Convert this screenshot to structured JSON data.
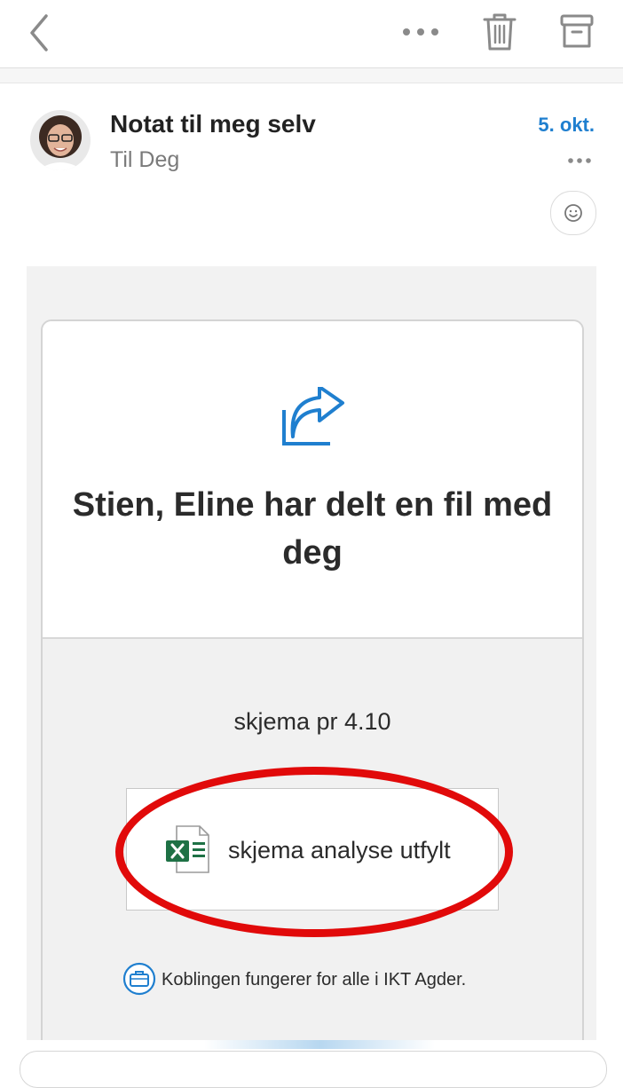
{
  "header": {
    "back_icon": "chevron-left-icon",
    "more_icon": "ellipsis-icon",
    "delete_icon": "trash-icon",
    "archive_icon": "archive-icon"
  },
  "message": {
    "subject": "Notat til meg selv",
    "to": "Til Deg",
    "date": "5. okt.",
    "accent_color": "#1f7fcf"
  },
  "share_card": {
    "headline": "Stien, Eline har delt en fil med deg",
    "note": "skjema pr 4.10",
    "file": {
      "name": "skjema analyse utfylt",
      "icon": "excel-icon"
    },
    "access_text": "Koblingen fungerer for alle i IKT Agder.",
    "annotation_color": "#e10a0a"
  }
}
